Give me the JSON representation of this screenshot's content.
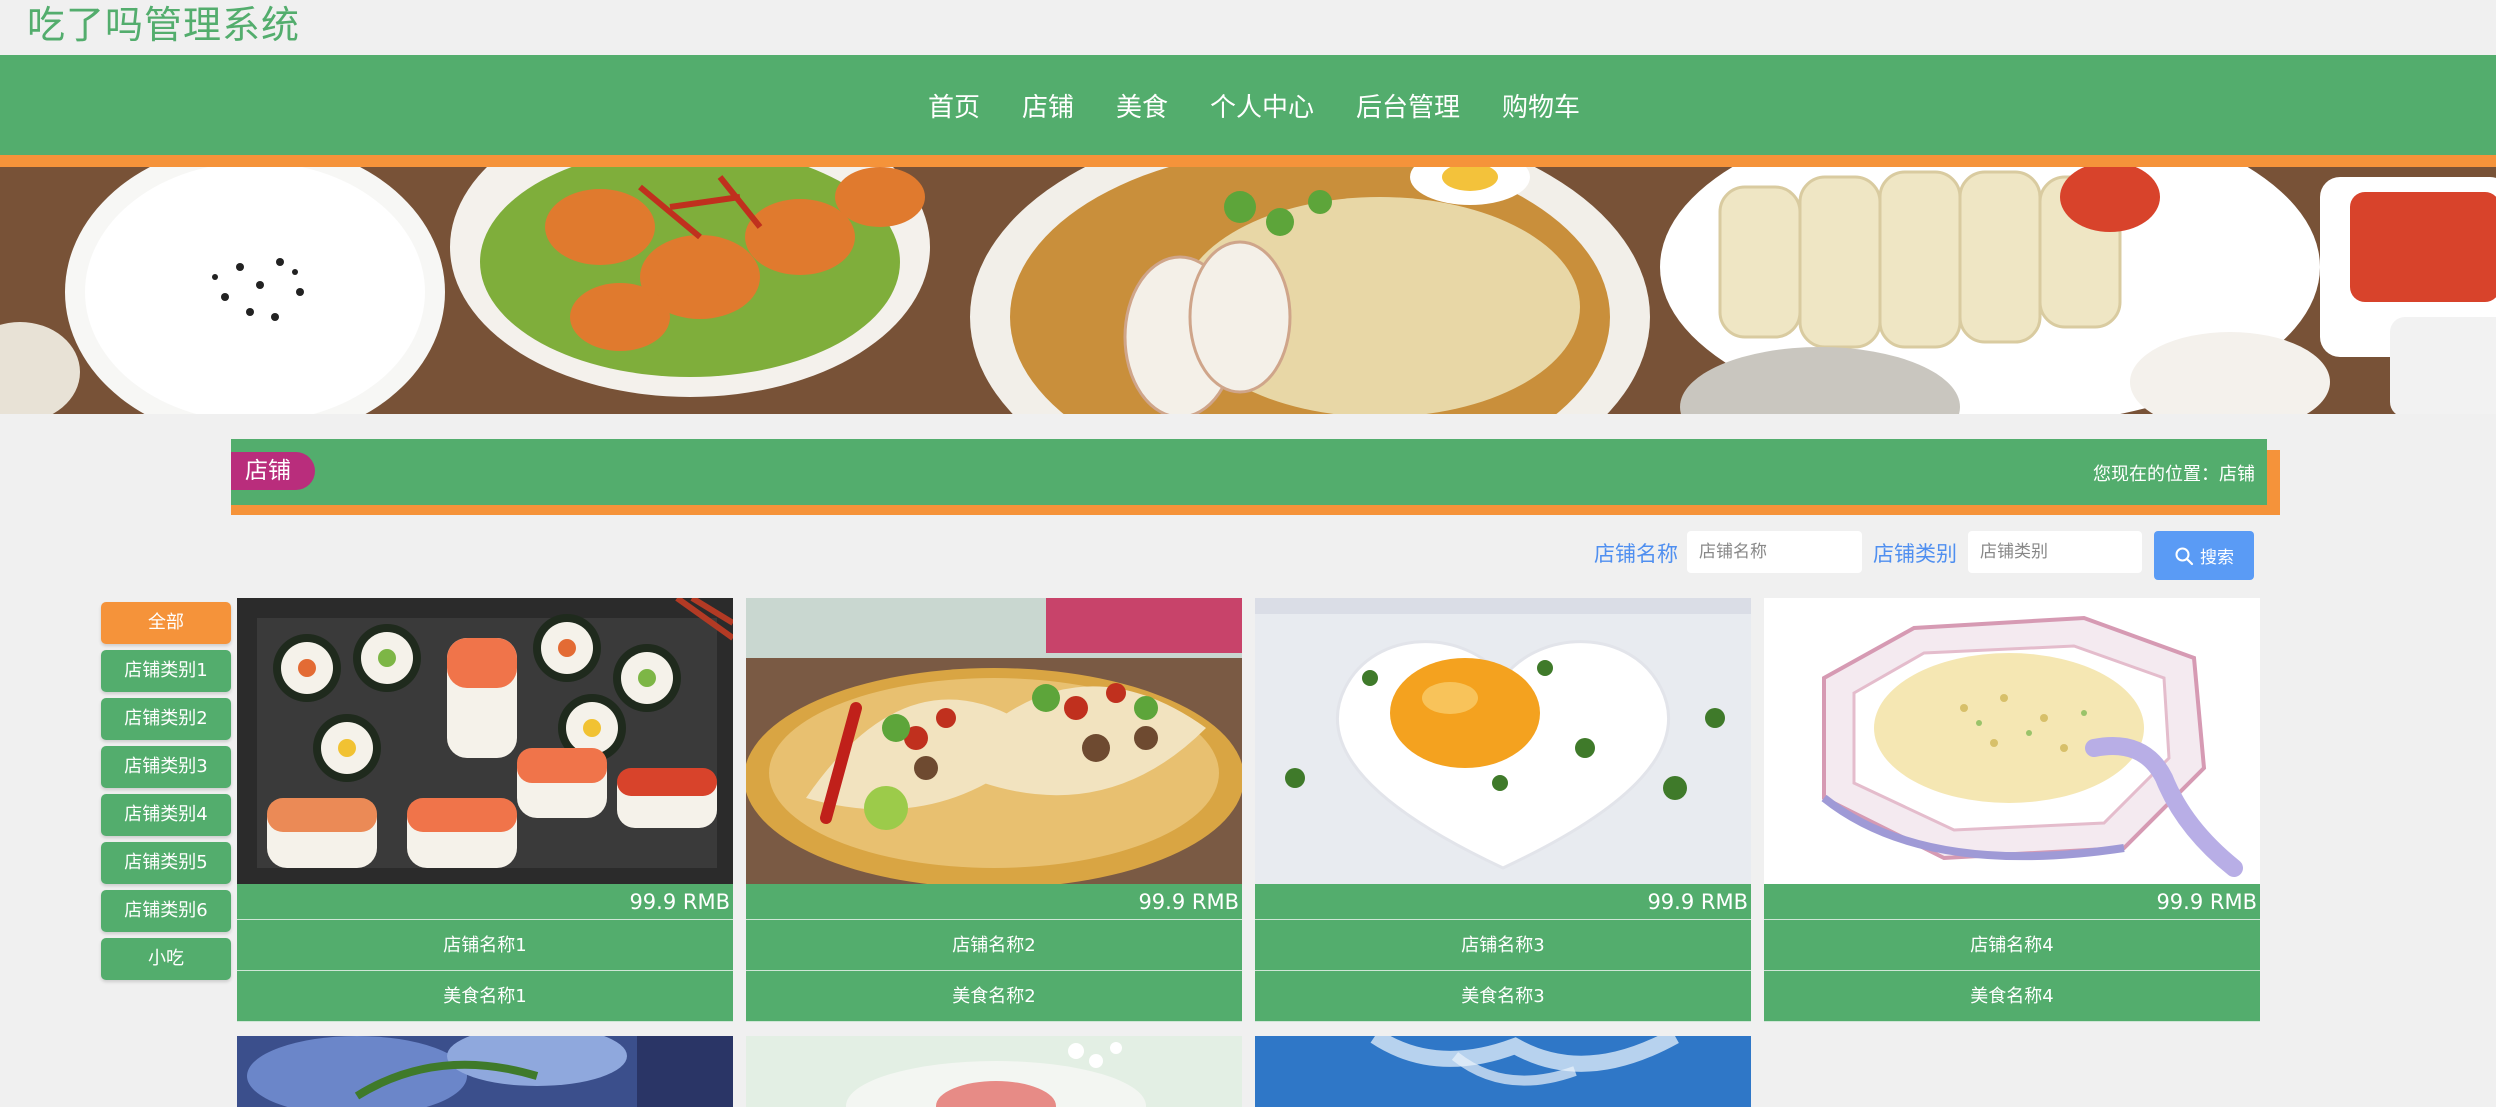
{
  "site": {
    "title": "吃了吗管理系统"
  },
  "nav": {
    "items": [
      "首页",
      "店铺",
      "美食",
      "个人中心",
      "后台管理",
      "购物车"
    ]
  },
  "section": {
    "tag": "店铺",
    "breadcrumb": "您现在的位置：店铺"
  },
  "filters": {
    "shop_name_label": "店铺名称",
    "shop_name_placeholder": "店铺名称",
    "shop_type_label": "店铺类别",
    "shop_type_placeholder": "店铺类别",
    "search_label": "搜索"
  },
  "categories": [
    "全部",
    "店铺类别1",
    "店铺类别2",
    "店铺类别3",
    "店铺类别4",
    "店铺类别5",
    "店铺类别6",
    "小吃"
  ],
  "cards": [
    {
      "price": "99.9 RMB",
      "shop": "店铺名称1",
      "food": "美食名称1",
      "image": "sushi"
    },
    {
      "price": "99.9 RMB",
      "shop": "店铺名称2",
      "food": "美食名称2",
      "image": "tacos"
    },
    {
      "price": "99.9 RMB",
      "shop": "店铺名称3",
      "food": "美食名称3",
      "image": "fried-egg"
    },
    {
      "price": "99.9 RMB",
      "shop": "店铺名称4",
      "food": "美食名称4",
      "image": "fried-rice-sketch"
    }
  ],
  "colors": {
    "green": "#53ad6d",
    "orange": "#f5933a",
    "magenta": "#b92d7c",
    "blue": "#5a9bf5"
  }
}
